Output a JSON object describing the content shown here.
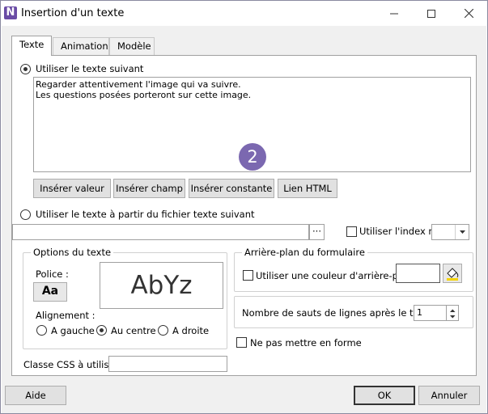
{
  "window": {
    "title": "Insertion d'un texte",
    "app_icon": "N"
  },
  "tabs": [
    {
      "label": "Texte",
      "active": true
    },
    {
      "label": "Animation",
      "active": false
    },
    {
      "label": "Modèle",
      "active": false
    }
  ],
  "text_option": {
    "use_text_label": "Utiliser le texte suivant",
    "text_value": "Regarder attentivement l'image qui va suivre.\nLes questions posées porteront sur cette image.",
    "badge_number": "2",
    "buttons": {
      "insert_value": "Insérer valeur",
      "insert_field": "Insérer champ",
      "insert_constant": "Insérer constante",
      "html_link": "Lien HTML"
    }
  },
  "file_option": {
    "label": "Utiliser le texte à partir du fichier texte suivant",
    "browse_label": "···",
    "use_index_label": "Utiliser l'index no"
  },
  "text_options_group": {
    "title": "Options du texte",
    "font_label": "Police :",
    "font_button": "Aa",
    "preview": "AbYz",
    "alignment_label": "Alignement :",
    "align_left": "A gauche",
    "align_center": "Au centre",
    "align_right": "A droite"
  },
  "background_group": {
    "title": "Arrière-plan du formulaire",
    "use_color_label": "Utiliser une couleur d'arrière-plan"
  },
  "line_breaks": {
    "label": "Nombre de sauts de lignes après le texte :",
    "value": "1"
  },
  "no_format_label": "Ne pas mettre en forme",
  "css_class_label": "Classe CSS à utiliser",
  "footer": {
    "help": "Aide",
    "ok": "OK",
    "cancel": "Annuler"
  }
}
